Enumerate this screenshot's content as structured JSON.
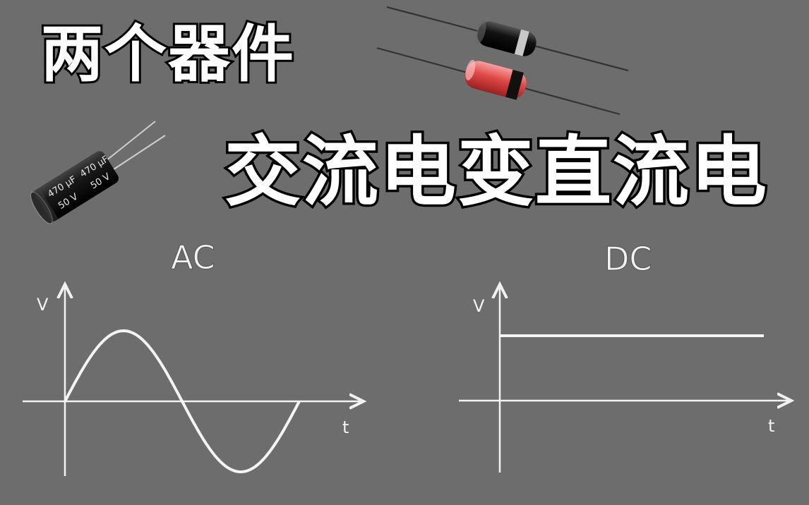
{
  "headline": {
    "small": "两个器件",
    "big": "交流电变直流电"
  },
  "components": {
    "capacitor": {
      "icon": "capacitor-icon",
      "marking_1": "470 μF",
      "marking_2": "50 V"
    },
    "diodes": {
      "icon": "diode-icon",
      "colors": [
        "#111111",
        "#e85a5a"
      ]
    }
  },
  "graphs": {
    "ac": {
      "label": "AC",
      "y_axis": "V",
      "x_axis": "t"
    },
    "dc": {
      "label": "DC",
      "y_axis": "V",
      "x_axis": "t"
    }
  }
}
